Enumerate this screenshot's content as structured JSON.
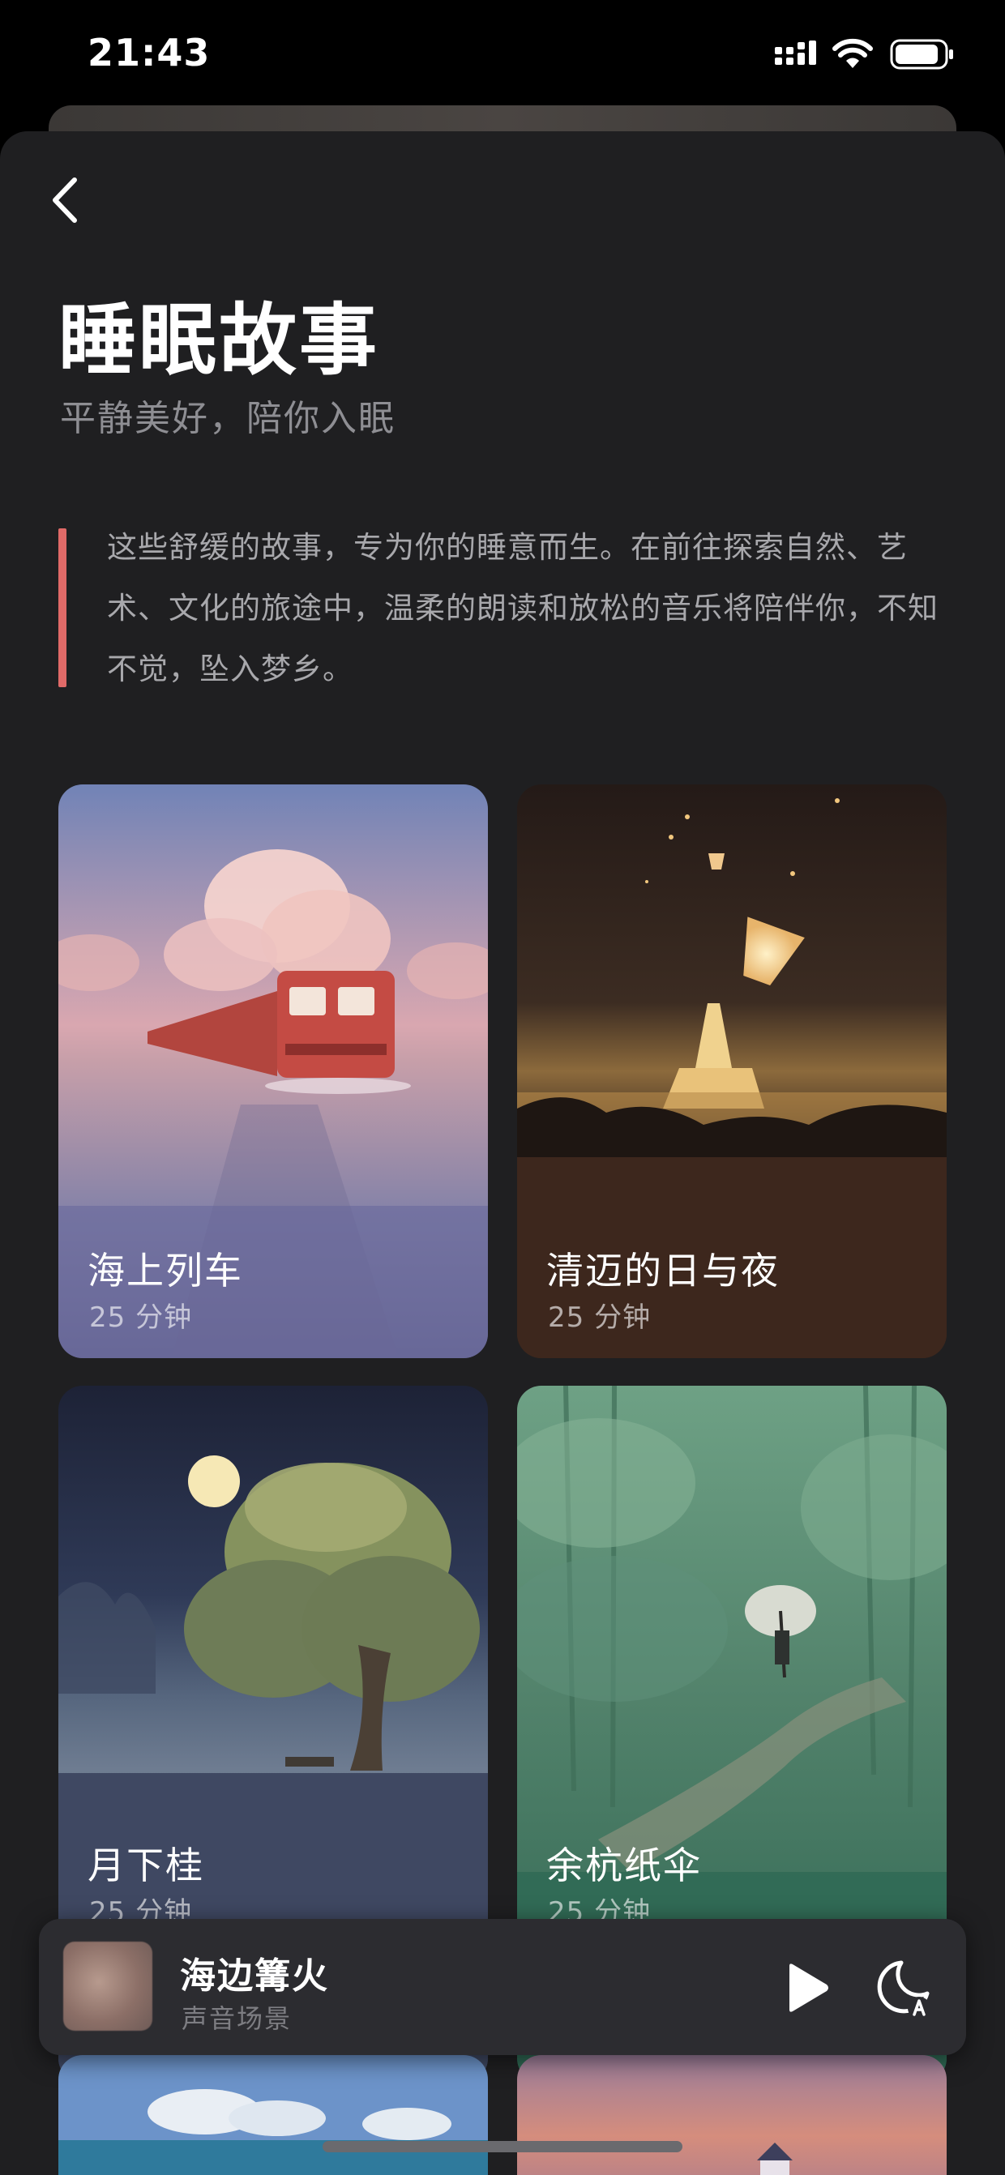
{
  "status_bar": {
    "time": "21:43"
  },
  "header": {
    "title": "睡眠故事",
    "subtitle": "平静美好，陪你入眠"
  },
  "intro": {
    "text": "这些舒缓的故事，专为你的睡意而生。在前往探索自然、艺术、文化的旅途中，温柔的朗读和放松的音乐将陪伴你，不知不觉，坠入梦乡。",
    "accent_color": "#e06a68"
  },
  "stories": [
    {
      "title": "海上列车",
      "duration": "25 分钟",
      "icon": "train-illustration"
    },
    {
      "title": "清迈的日与夜",
      "duration": "25 分钟",
      "icon": "lantern-temple-illustration"
    },
    {
      "title": "月下桂",
      "duration": "25 分钟",
      "icon": "moon-tree-illustration"
    },
    {
      "title": "余杭纸伞",
      "duration": "25 分钟",
      "icon": "bamboo-umbrella-illustration"
    }
  ],
  "now_playing": {
    "title": "海边篝火",
    "subtitle": "声音场景",
    "play_icon": "play-icon",
    "sleep_icon": "sleep-timer-icon"
  },
  "colors": {
    "background": "#1f1f21",
    "mini_player": "#2c2c30"
  }
}
